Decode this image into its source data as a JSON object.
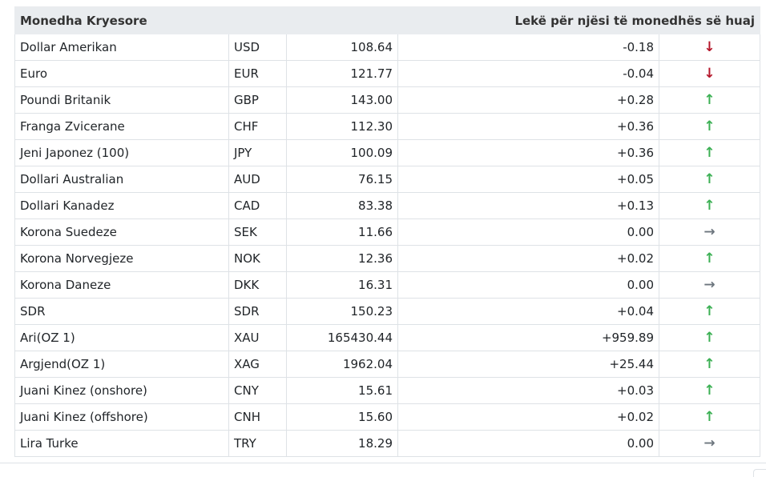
{
  "header": {
    "title": "Monedha Kryesore",
    "subtitle": "Lekë për njësi të monedhës së huaj"
  },
  "colors": {
    "down": "#b5172b",
    "up": "#3cb054",
    "flat": "#6c757d",
    "header_bg": "#e9ecef"
  },
  "rows": [
    {
      "name": "Dollar Amerikan",
      "code": "USD",
      "rate": "108.64",
      "change": "-0.18",
      "direction": "down",
      "icon": "arrow-down-icon"
    },
    {
      "name": "Euro",
      "code": "EUR",
      "rate": "121.77",
      "change": "-0.04",
      "direction": "down",
      "icon": "arrow-down-icon"
    },
    {
      "name": "Poundi Britanik",
      "code": "GBP",
      "rate": "143.00",
      "change": "+0.28",
      "direction": "up",
      "icon": "arrow-up-icon"
    },
    {
      "name": "Franga Zvicerane",
      "code": "CHF",
      "rate": "112.30",
      "change": "+0.36",
      "direction": "up",
      "icon": "arrow-up-icon"
    },
    {
      "name": "Jeni Japonez (100)",
      "code": "JPY",
      "rate": "100.09",
      "change": "+0.36",
      "direction": "up",
      "icon": "arrow-up-icon"
    },
    {
      "name": "Dollari Australian",
      "code": "AUD",
      "rate": "76.15",
      "change": "+0.05",
      "direction": "up",
      "icon": "arrow-up-icon"
    },
    {
      "name": "Dollari Kanadez",
      "code": "CAD",
      "rate": "83.38",
      "change": "+0.13",
      "direction": "up",
      "icon": "arrow-up-icon"
    },
    {
      "name": "Korona Suedeze",
      "code": "SEK",
      "rate": "11.66",
      "change": "0.00",
      "direction": "flat",
      "icon": "arrow-right-icon"
    },
    {
      "name": "Korona Norvegjeze",
      "code": "NOK",
      "rate": "12.36",
      "change": "+0.02",
      "direction": "up",
      "icon": "arrow-up-icon"
    },
    {
      "name": "Korona Daneze",
      "code": "DKK",
      "rate": "16.31",
      "change": "0.00",
      "direction": "flat",
      "icon": "arrow-right-icon"
    },
    {
      "name": "SDR",
      "code": "SDR",
      "rate": "150.23",
      "change": "+0.04",
      "direction": "up",
      "icon": "arrow-up-icon"
    },
    {
      "name": "Ari(OZ 1)",
      "code": "XAU",
      "rate": "165430.44",
      "change": "+959.89",
      "direction": "up",
      "icon": "arrow-up-icon"
    },
    {
      "name": "Argjend(OZ 1)",
      "code": "XAG",
      "rate": "1962.04",
      "change": "+25.44",
      "direction": "up",
      "icon": "arrow-up-icon"
    },
    {
      "name": "Juani Kinez (onshore)",
      "code": "CNY",
      "rate": "15.61",
      "change": "+0.03",
      "direction": "up",
      "icon": "arrow-up-icon"
    },
    {
      "name": "Juani Kinez (offshore)",
      "code": "CNH",
      "rate": "15.60",
      "change": "+0.02",
      "direction": "up",
      "icon": "arrow-up-icon"
    },
    {
      "name": "Lira Turke",
      "code": "TRY",
      "rate": "18.29",
      "change": "0.00",
      "direction": "flat",
      "icon": "arrow-right-icon"
    }
  ]
}
